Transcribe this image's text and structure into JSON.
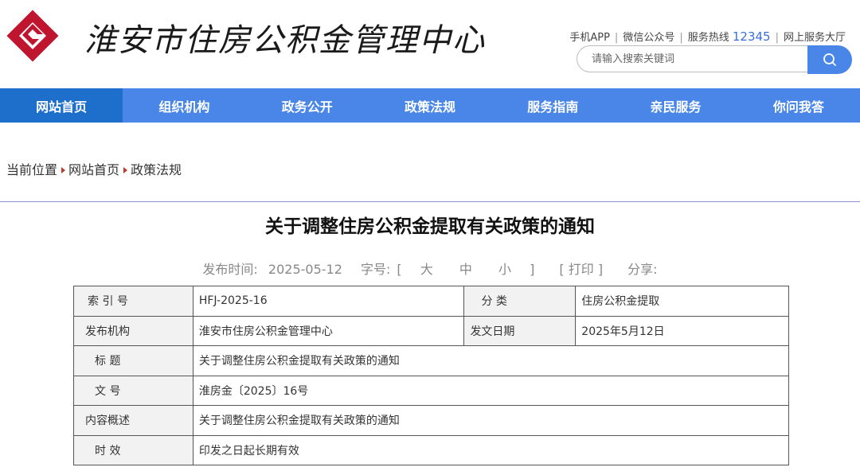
{
  "header": {
    "site_title": "淮安市住房公积金管理中心",
    "links": [
      "手机APP",
      "微信公众号",
      "服务热线"
    ],
    "hotline": "12345",
    "online_hall": "网上服务大厅",
    "search_placeholder": "请输入搜索关键词"
  },
  "nav": [
    "网站首页",
    "组织机构",
    "政务公开",
    "政策法规",
    "服务指南",
    "亲民服务",
    "你问我答"
  ],
  "breadcrumb": {
    "prefix": "当前位置",
    "items": [
      "网站首页",
      "政策法规"
    ]
  },
  "article": {
    "title": "关于调整住房公积金提取有关政策的通知",
    "publish_label": "发布时间:",
    "publish_date": "2025-05-12",
    "font_label": "字号:",
    "font_open": "[",
    "font_large": "大",
    "font_medium": "中",
    "font_small": "小",
    "font_close": "]",
    "print": "[ 打印 ]",
    "share": "分享:"
  },
  "info_table": {
    "index_label": "索 引 号",
    "index_value": "HFJ-2025-16",
    "category_label": "分 类",
    "category_value": "住房公积金提取",
    "issuer_label": "发布机构",
    "issuer_value": "淮安市住房公积金管理中心",
    "date_label": "发文日期",
    "date_value": "2025年5月12日",
    "title_label": "标 题",
    "title_value": "关于调整住房公积金提取有关政策的通知",
    "doc_no_label": "文 号",
    "doc_no_value": "淮房金〔2025〕16号",
    "summary_label": "内容概述",
    "summary_value": "关于调整住房公积金提取有关政策的通知",
    "validity_label": "时 效",
    "validity_value": "印发之日起长期有效"
  },
  "colors": {
    "nav": "#4a86e8",
    "nav_active": "#1e6fcc",
    "logo": "#c0152f"
  }
}
